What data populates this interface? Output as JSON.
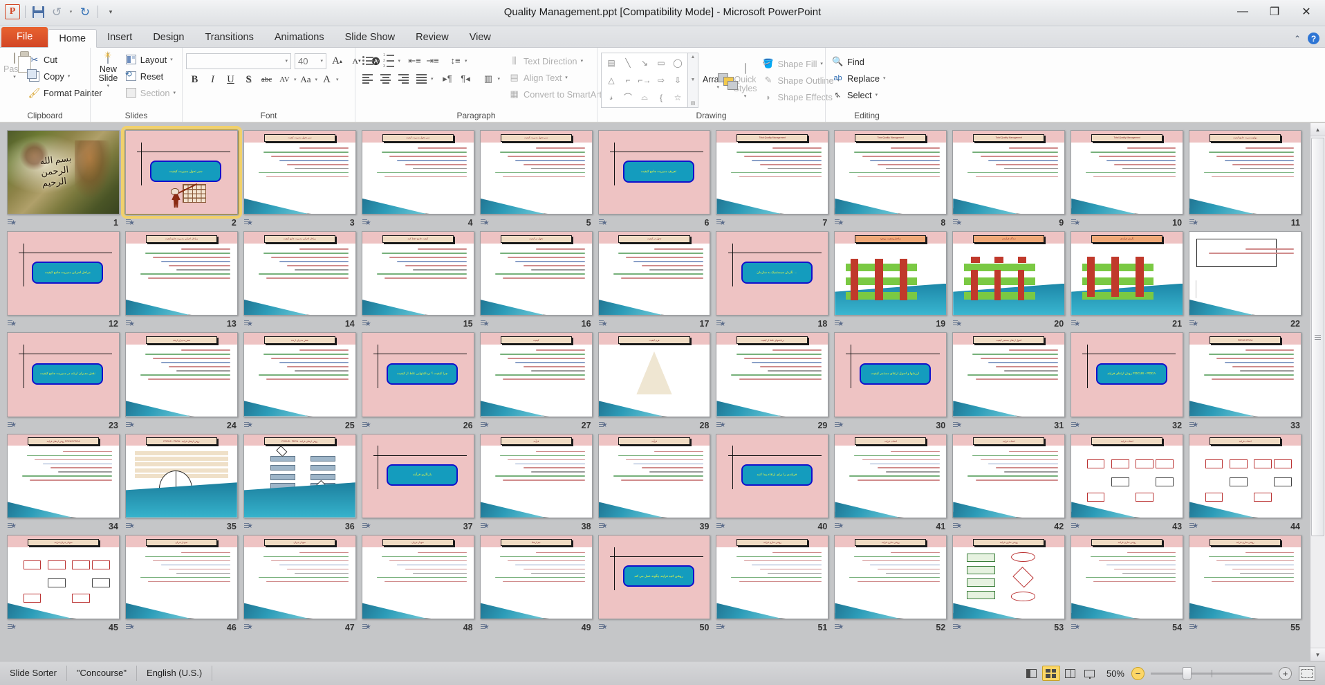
{
  "window": {
    "title": "Quality Management.ppt [Compatibility Mode]  -  Microsoft PowerPoint",
    "minimize": "—",
    "restore": "❐",
    "close": "✕"
  },
  "quick_access": {
    "app_logo": "P",
    "save": "save-icon",
    "undo": "↺",
    "redo": "↻",
    "customize": "▾"
  },
  "tabs": [
    {
      "label": "File",
      "active": false,
      "file": true
    },
    {
      "label": "Home",
      "active": true
    },
    {
      "label": "Insert",
      "active": false
    },
    {
      "label": "Design",
      "active": false
    },
    {
      "label": "Transitions",
      "active": false
    },
    {
      "label": "Animations",
      "active": false
    },
    {
      "label": "Slide Show",
      "active": false
    },
    {
      "label": "Review",
      "active": false
    },
    {
      "label": "View",
      "active": false
    }
  ],
  "ribbon": {
    "collapse_icon": "⌃",
    "help_icon": "?",
    "clipboard": {
      "label": "Clipboard",
      "paste": "Paste",
      "cut": "Cut",
      "copy": "Copy",
      "format_painter": "Format Painter",
      "launcher": "◢"
    },
    "slides": {
      "label": "Slides",
      "new_slide": "New Slide",
      "layout": "Layout",
      "reset": "Reset",
      "section": "Section"
    },
    "font": {
      "label": "Font",
      "font_name": "",
      "font_size": "40",
      "bold": "B",
      "italic": "I",
      "underline": "U",
      "shadow": "S",
      "strikethrough": "abc",
      "spacing": "AV",
      "case": "Aa",
      "color": "A",
      "grow": "A",
      "shrink": "A",
      "clear": "clear-formatting-icon",
      "launcher": "◢"
    },
    "paragraph": {
      "label": "Paragraph",
      "bullets": "bullets-icon",
      "numbering": "numbering-icon",
      "decrease_indent": "decrease-indent-icon",
      "increase_indent": "increase-indent-icon",
      "line_spacing": "line-spacing-icon",
      "align_left": "align-left-icon",
      "align_center": "align-center-icon",
      "align_right": "align-right-icon",
      "justify": "justify-icon",
      "ltr": "▸¶",
      "rtl": "¶◂",
      "columns": "columns-icon",
      "text_direction": "Text Direction",
      "align_text": "Align Text",
      "convert_smartart": "Convert to SmartArt",
      "launcher": "◢"
    },
    "drawing": {
      "label": "Drawing",
      "shapes": [
        "textbox",
        "line",
        "arrow",
        "rectangle",
        "oval",
        "rounded-rect",
        "triangle",
        "elbow",
        "elbow-arrow",
        "right-arrow",
        "down-arrow",
        "cloud",
        "scribble",
        "curve",
        "arc",
        "left-brace",
        "right-brace",
        "star"
      ],
      "arrange": "Arrange",
      "quick_styles": "Quick Styles",
      "shape_fill": "Shape Fill",
      "shape_outline": "Shape Outline",
      "shape_effects": "Shape Effects",
      "launcher": "◢"
    },
    "editing": {
      "label": "Editing",
      "find": "Find",
      "replace": "Replace",
      "select": "Select"
    }
  },
  "status_bar": {
    "view_mode": "Slide Sorter",
    "theme": "\"Concourse\"",
    "language": "English (U.S.)",
    "zoom_level": "50%",
    "zoom_out": "−",
    "zoom_in": "+",
    "views": [
      {
        "name": "normal-view",
        "active": false
      },
      {
        "name": "slide-sorter-view",
        "active": true
      },
      {
        "name": "reading-view",
        "active": false
      },
      {
        "name": "slide-show-view",
        "active": false
      }
    ],
    "fit_to_window": "fit-slide-icon"
  },
  "scrollbar": {
    "up": "▲",
    "down": "▼",
    "thumb_position_pct": 0
  },
  "presentation": {
    "total_visible": 55,
    "selected_slide": 2,
    "slides": [
      {
        "n": 1,
        "kind": "image",
        "title": "بسم الله الرحمن الرحیم"
      },
      {
        "n": 2,
        "kind": "section",
        "title": "سیر تحول مدیریت کیفیت",
        "art": "pointer-man"
      },
      {
        "n": 3,
        "kind": "content",
        "header": "سیر تحول مدیریت کیفیت",
        "body": "bracket-diagram"
      },
      {
        "n": 4,
        "kind": "content",
        "header": "سیر تحول مدیریت کیفیت",
        "body": "bullets"
      },
      {
        "n": 5,
        "kind": "content",
        "header": "سیر تحول مدیریت کیفیت",
        "body": "bullets"
      },
      {
        "n": 6,
        "kind": "section",
        "title": "تعریف مدیریت جامع کیفیت"
      },
      {
        "n": 7,
        "kind": "content",
        "header": "Total Quality Management",
        "body": "bullets"
      },
      {
        "n": 8,
        "kind": "content",
        "header": "Total Quality Management",
        "body": "bullets"
      },
      {
        "n": 9,
        "kind": "content",
        "header": "Total Quality Management",
        "body": "bullets"
      },
      {
        "n": 10,
        "kind": "content",
        "header": "Total Quality Management",
        "body": "bullets"
      },
      {
        "n": 11,
        "kind": "content",
        "header": "موانع مدیریت جامع کیفیت",
        "body": "bullets"
      },
      {
        "n": 12,
        "kind": "section",
        "title": "مراحل اجرایی مدیریت جامع کیفیت"
      },
      {
        "n": 13,
        "kind": "content",
        "header": "مراحل اجرایی مدیریت جامع کیفیت",
        "body": "bullets"
      },
      {
        "n": 14,
        "kind": "content",
        "header": "مراحل اجرایی مدیریت جامع کیفیت",
        "body": "bullets"
      },
      {
        "n": 15,
        "kind": "content",
        "header": "کیفیت جامع حفظ کنید",
        "body": "bullets"
      },
      {
        "n": 16,
        "kind": "content",
        "header": "تحول در کیفیت",
        "body": "process-diagram"
      },
      {
        "n": 17,
        "kind": "content",
        "header": "تحول در کیفیت",
        "body": "bullets"
      },
      {
        "n": 18,
        "kind": "section",
        "title": "نگرش سیستمیک به سازمان ..."
      },
      {
        "n": 19,
        "kind": "diagram",
        "header": "ساختار وضعیت موجود",
        "body": "pillars-vertical"
      },
      {
        "n": 20,
        "kind": "diagram",
        "header": "دیدگاه فرآیندی",
        "body": "pillars-horizontal"
      },
      {
        "n": 21,
        "kind": "diagram",
        "header": "نگرش فرآیندی",
        "body": "pillars-grid"
      },
      {
        "n": 22,
        "kind": "diagram",
        "header": "",
        "body": "arrow-alignment"
      },
      {
        "n": 23,
        "kind": "section",
        "title": "نقش مدیران ارشد در مدیریت جامع کیفیت"
      },
      {
        "n": 24,
        "kind": "content",
        "header": "نقش مدیران ارشد",
        "body": "bullets"
      },
      {
        "n": 25,
        "kind": "content",
        "header": "نقش مدیران ارشد",
        "body": "bullets"
      },
      {
        "n": 26,
        "kind": "section",
        "title": "چرا کیفیت ؟ برداشتهایی غلط از کیفیت"
      },
      {
        "n": 27,
        "kind": "content",
        "header": "کیفیت",
        "body": "bullets"
      },
      {
        "n": 28,
        "kind": "diagram",
        "header": "هرم کیفیت",
        "body": "triangle"
      },
      {
        "n": 29,
        "kind": "content",
        "header": "برداشتهای غلط از کیفیت",
        "body": "bullets"
      },
      {
        "n": 30,
        "kind": "section",
        "title": "ارزشها و اصول ارتقای مستمر کیفیت"
      },
      {
        "n": 31,
        "kind": "content",
        "header": "اصول ارتقای مستمر کیفیت",
        "body": "bullets"
      },
      {
        "n": 32,
        "kind": "section",
        "title": "روش ارتقای فرایند FOCUS - PDCA"
      },
      {
        "n": 33,
        "kind": "content",
        "header": "FOCUS  PDCA",
        "body": "bullets"
      },
      {
        "n": 34,
        "kind": "content",
        "header": "روش ارتقای فرایند FOCUS PDCA",
        "body": "bullets"
      },
      {
        "n": 35,
        "kind": "diagram",
        "header": "FOCUS - PDCA : روش ارتقای فرایند",
        "body": "focus-pdca-wheel"
      },
      {
        "n": 36,
        "kind": "diagram",
        "header": "FOCUS - PDCA : روش ارتقای فرایند",
        "body": "flowchart"
      },
      {
        "n": 37,
        "kind": "section",
        "title": "بازنگری فرآیند"
      },
      {
        "n": 38,
        "kind": "content",
        "header": "فرآیند",
        "body": "bullets"
      },
      {
        "n": 39,
        "kind": "content",
        "header": "فرآیند",
        "body": "bullets"
      },
      {
        "n": 40,
        "kind": "section",
        "title": "فرایندی را برای ارتقاء پیدا کنید"
      },
      {
        "n": 41,
        "kind": "content",
        "header": "انتخاب فرایند",
        "body": "bullets"
      },
      {
        "n": 42,
        "kind": "content",
        "header": "انتخاب فرایند",
        "body": "bullets"
      },
      {
        "n": 43,
        "kind": "diagram",
        "header": "انتخاب فرایند",
        "body": "flow-boxes"
      },
      {
        "n": 44,
        "kind": "diagram",
        "header": "انتخاب فرایند",
        "body": "flow-boxes"
      },
      {
        "n": 45,
        "kind": "diagram",
        "header": "نمودار جریان فرایند",
        "body": "flow-boxes"
      },
      {
        "n": 46,
        "kind": "content",
        "header": "نمودار جریان",
        "body": "bullets"
      },
      {
        "n": 47,
        "kind": "content",
        "header": "نمودار جریان",
        "body": "bullets"
      },
      {
        "n": 48,
        "kind": "content",
        "header": "نمودار جریان",
        "body": "bullets"
      },
      {
        "n": 49,
        "kind": "content",
        "header": "تیم ارتقاء",
        "body": "bullets"
      },
      {
        "n": 50,
        "kind": "section",
        "title": "روشن کنید فرایند چگونه عمل می کند"
      },
      {
        "n": 51,
        "kind": "content",
        "header": "روشن سازی فرایند",
        "body": "bullets"
      },
      {
        "n": 52,
        "kind": "content",
        "header": "روشن سازی فرایند",
        "body": "bullets"
      },
      {
        "n": 53,
        "kind": "diagram",
        "header": "روشن سازی فرایند",
        "body": "flow-mixed"
      },
      {
        "n": 54,
        "kind": "content",
        "header": "روشن سازی فرایند",
        "body": "bullets"
      },
      {
        "n": 55,
        "kind": "content",
        "header": "روشن سازی فرایند",
        "body": "bullets"
      }
    ]
  }
}
